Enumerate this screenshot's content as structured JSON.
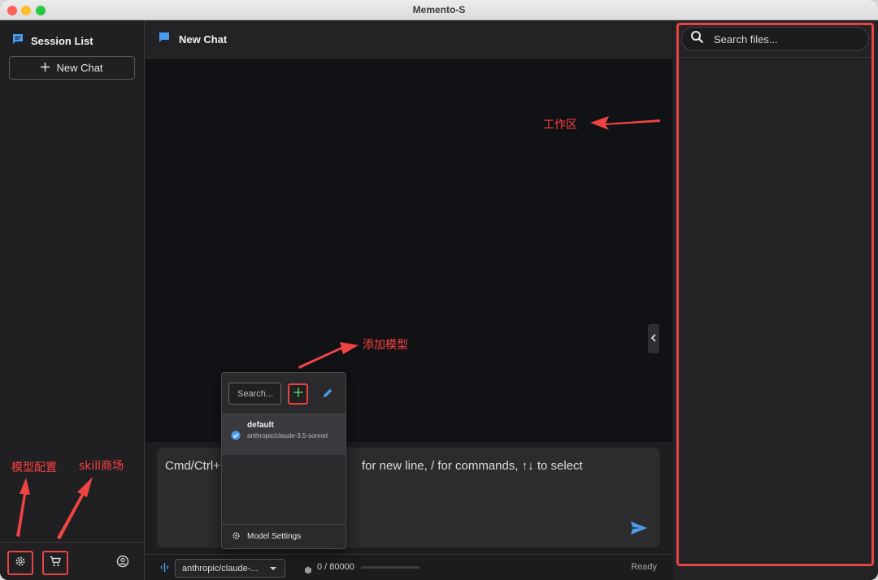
{
  "window": {
    "title": "Memento-S"
  },
  "sidebar": {
    "header_icon": "chat-bubble-icon",
    "title": "Session List",
    "new_chat_label": "New Chat",
    "footer": {
      "settings_icon": "gear-icon",
      "store_icon": "shopping-cart-icon",
      "account_icon": "user-circle-icon"
    }
  },
  "main": {
    "header_icon": "chat-bubble-icon",
    "title": "New Chat",
    "composer": {
      "placeholder_start": "Cmd/Ctrl+",
      "placeholder_end": "for new line, / for commands, ↑↓ to select"
    },
    "status": {
      "model_select": "anthropic/claude-...",
      "token_count": "0 / 80000",
      "token_fraction": 0,
      "state": "Ready"
    }
  },
  "model_popup": {
    "search_placeholder": "Search...",
    "add_icon": "plus-icon",
    "edit_icon": "pencil-icon",
    "models": [
      {
        "name": "default",
        "id": "anthropic/claude-3.5-sonnet",
        "selected": true
      }
    ],
    "settings_label": "Model Settings"
  },
  "workspace": {
    "search_placeholder": "Search files..."
  },
  "annotations": {
    "workspace": "工作区",
    "add_model": "添加模型",
    "model_config": "模型配置",
    "skill_store": "skill商场"
  },
  "colors": {
    "accent": "#4a9cf0",
    "annotation": "#e84343",
    "add_green": "#55c86a"
  }
}
